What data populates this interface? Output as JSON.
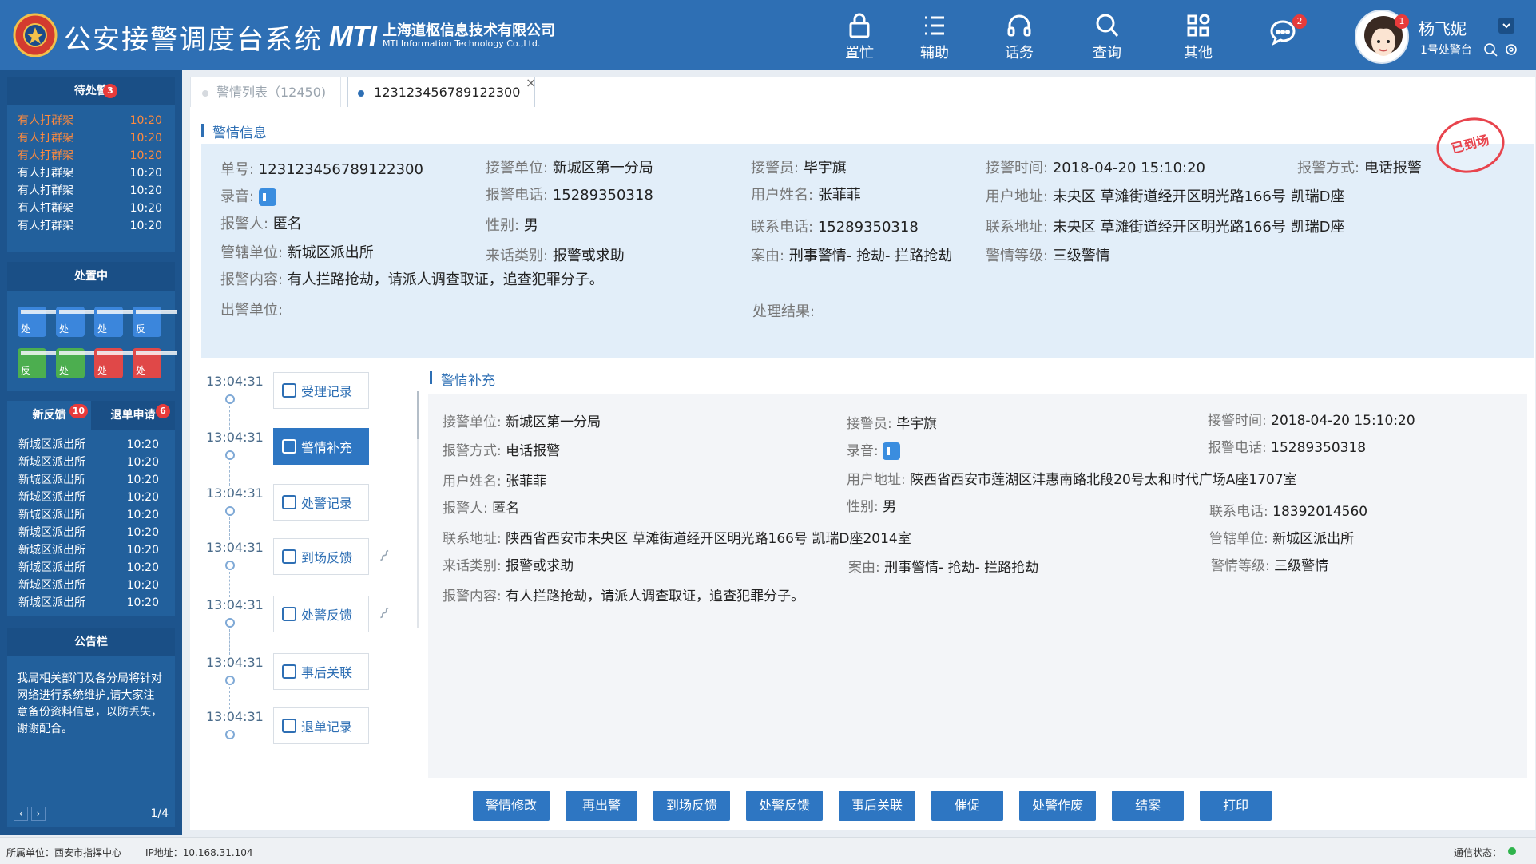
{
  "header": {
    "title": "公安接警调度台系统",
    "mti_logo": "MTI",
    "mti_cn": "上海道枢信息技术有限公司",
    "mti_en": "MTI Information Technology Co.,Ltd.",
    "nav": [
      {
        "label": "置忙",
        "icon": "lock-icon"
      },
      {
        "label": "辅助",
        "icon": "list-icon"
      },
      {
        "label": "话务",
        "icon": "headset-icon"
      },
      {
        "label": "查询",
        "icon": "search-icon"
      },
      {
        "label": "其他",
        "icon": "grid-icon"
      }
    ],
    "chat_badge": "2",
    "user": {
      "name": "杨飞妮",
      "seat": "1号处警台",
      "badge": "1"
    }
  },
  "left": {
    "pending": {
      "title": "待处警",
      "badge": "3",
      "rows": [
        {
          "text": "有人打群架",
          "time": "10:20"
        },
        {
          "text": "有人打群架",
          "time": "10:20"
        },
        {
          "text": "有人打群架",
          "time": "10:20"
        },
        {
          "text": "有人打群架",
          "time": "10:20"
        },
        {
          "text": "有人打群架",
          "time": "10:20"
        },
        {
          "text": "有人打群架",
          "time": "10:20"
        },
        {
          "text": "有人打群架",
          "time": "10:20"
        }
      ]
    },
    "dispatching": {
      "title": "处置中",
      "icons": [
        {
          "t": "处",
          "c": "#3b86dc"
        },
        {
          "t": "处",
          "c": "#3b86dc"
        },
        {
          "t": "处",
          "c": "#3b86dc"
        },
        {
          "t": "反",
          "c": "#3b86dc"
        },
        {
          "t": "反",
          "c": "#4cae4f"
        },
        {
          "t": "处",
          "c": "#4cae4f"
        },
        {
          "t": "处",
          "c": "#e04848"
        },
        {
          "t": "处",
          "c": "#e04848"
        }
      ]
    },
    "feedback": {
      "tab_new": "新反馈",
      "tab_new_badge": "10",
      "tab_back": "退单申请",
      "tab_back_badge": "6",
      "rows": [
        {
          "text": "新城区派出所",
          "time": "10:20"
        },
        {
          "text": "新城区派出所",
          "time": "10:20"
        },
        {
          "text": "新城区派出所",
          "time": "10:20"
        },
        {
          "text": "新城区派出所",
          "time": "10:20"
        },
        {
          "text": "新城区派出所",
          "time": "10:20"
        },
        {
          "text": "新城区派出所",
          "time": "10:20"
        },
        {
          "text": "新城区派出所",
          "time": "10:20"
        },
        {
          "text": "新城区派出所",
          "time": "10:20"
        },
        {
          "text": "新城区派出所",
          "time": "10:20"
        },
        {
          "text": "新城区派出所",
          "time": "10:20"
        }
      ]
    },
    "notice": {
      "title": "公告栏",
      "text": "我局相关部门及各分局将针对网络进行系统维护,请大家注意备份资料信息，以防丢失，谢谢配合。",
      "page": "1/4"
    }
  },
  "tabs": {
    "list": "警情列表（12450)",
    "active": "123123456789122300"
  },
  "info": {
    "title": "警情信息",
    "stamp": "已到场",
    "fields": {
      "no_k": "单号:",
      "no_v": "123123456789122300",
      "unit_k": "接警单位:",
      "unit_v": "新城区第一分局",
      "officer_k": "接警员:",
      "officer_v": "毕宇旗",
      "time_k": "接警时间:",
      "time_v": "2018-04-20 15:10:20",
      "method_k": "报警方式:",
      "method_v": "电话报警",
      "rec_k": "录音:",
      "phone_k": "报警电话:",
      "phone_v": "15289350318",
      "uname_k": "用户姓名:",
      "uname_v": "张菲菲",
      "uaddr_k": "用户地址:",
      "uaddr_v": "未央区 草滩街道经开区明光路166号 凯瑞D座",
      "reporter_k": "报警人:",
      "reporter_v": "匿名",
      "sex_k": "性别:",
      "sex_v": "男",
      "cphone_k": "联系电话:",
      "cphone_v": "15289350318",
      "caddr_k": "联系地址:",
      "caddr_v": "未央区 草滩街道经开区明光路166号 凯瑞D座",
      "jur_k": "管辖单位:",
      "jur_v": "新城区派出所",
      "ctype_k": "来话类别:",
      "ctype_v": "报警或求助",
      "case_k": "案由:",
      "case_v": "刑事警情- 抢劫- 拦路抢劫",
      "level_k": "警情等级:",
      "level_v": "三级警情",
      "content_k": "报警内容:",
      "content_v": "有人拦路抢劫，请派人调查取证，追查犯罪分子。",
      "dunit_k": "出警单位:",
      "result_k": "处理结果:"
    }
  },
  "timeline": {
    "items": [
      {
        "time": "13:04:31",
        "label": "受理记录"
      },
      {
        "time": "13:04:31",
        "label": "警情补充"
      },
      {
        "time": "13:04:31",
        "label": "处警记录"
      },
      {
        "time": "13:04:31",
        "label": "到场反馈"
      },
      {
        "time": "13:04:31",
        "label": "处警反馈"
      },
      {
        "time": "13:04:31",
        "label": "事后关联"
      },
      {
        "time": "13:04:31",
        "label": "退单记录"
      }
    ]
  },
  "supplement": {
    "title": "警情补充",
    "unit_k": "接警单位:",
    "unit_v": "新城区第一分局",
    "officer_k": "接警员:",
    "officer_v": "毕宇旗",
    "time_k": "接警时间:",
    "time_v": "2018-04-20 15:10:20",
    "method_k": "报警方式:",
    "method_v": "电话报警",
    "rec_k": "录音:",
    "phone_k": "报警电话:",
    "phone_v": "15289350318",
    "uname_k": "用户姓名:",
    "uname_v": "张菲菲",
    "uaddr_k": "用户地址:",
    "uaddr_v": "陕西省西安市莲湖区沣惠南路北段20号太和时代广场A座1707室",
    "reporter_k": "报警人:",
    "reporter_v": "匿名",
    "sex_k": "性别:",
    "sex_v": "男",
    "cphone_k": "联系电话:",
    "cphone_v": "18392014560",
    "caddr_k": "联系地址:",
    "caddr_v": "陕西省西安市未央区 草滩街道经开区明光路166号 凯瑞D座2014室",
    "jur_k": "管辖单位:",
    "jur_v": "新城区派出所",
    "ctype_k": "来话类别:",
    "ctype_v": "报警或求助",
    "case_k": "案由:",
    "case_v": "刑事警情- 抢劫- 拦路抢劫",
    "level_k": "警情等级:",
    "level_v": "三级警情",
    "content_k": "报警内容:",
    "content_v": "有人拦路抢劫，请派人调查取证，追查犯罪分子。"
  },
  "actions": [
    "警情修改",
    "再出警",
    "到场反馈",
    "处警反馈",
    "事后关联",
    "催促",
    "处警作废",
    "结案",
    "打印"
  ],
  "footer": {
    "unit": "所属单位：西安市指挥中心",
    "ip": "IP地址：10.168.31.104",
    "status": "通信状态："
  },
  "colors": {
    "primary": "#2e6fb4",
    "sidebar": "#1d548d",
    "hot": "#ff8a3d",
    "stamp": "#e8444d"
  }
}
